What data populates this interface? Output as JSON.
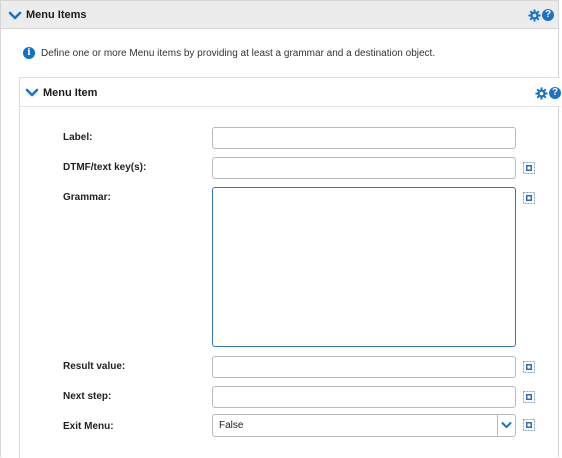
{
  "section": {
    "title": "Menu Items",
    "info_text": "Define one or more Menu items by providing at least a grammar and a destination object."
  },
  "menu_item": {
    "title": "Menu Item",
    "fields": {
      "label": {
        "label": "Label:",
        "value": ""
      },
      "dtmf": {
        "label": "DTMF/text key(s):",
        "value": ""
      },
      "grammar": {
        "label": "Grammar:",
        "value": ""
      },
      "result_value": {
        "label": "Result value:",
        "value": ""
      },
      "next_step": {
        "label": "Next step:",
        "value": ""
      },
      "exit_menu": {
        "label": "Exit Menu:",
        "value": "False"
      }
    }
  },
  "icons": {
    "collapse": "chevron-down-icon",
    "settings": "gear-icon",
    "help": "help-icon",
    "info": "info-icon",
    "expression": "expression-builder-icon"
  },
  "colors": {
    "accent": "#1a73c8",
    "header_bg": "#ececec",
    "focus_border": "#3a75b8"
  },
  "help_glyph": "?",
  "info_glyph": "i"
}
